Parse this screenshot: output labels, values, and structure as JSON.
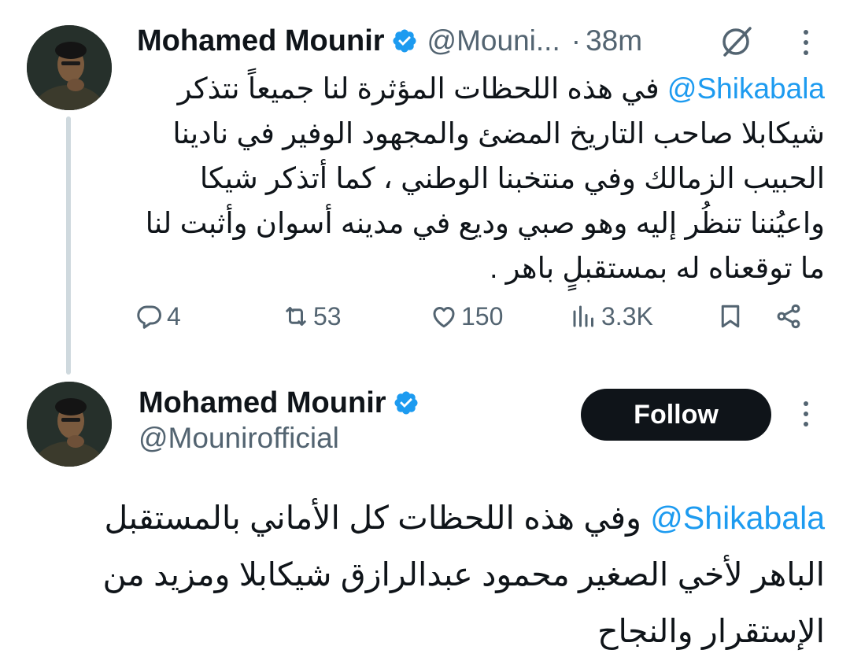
{
  "tweet1": {
    "display_name": "Mohamed Mounir",
    "handle": "@Mouni...",
    "separator": "·",
    "time": "38m",
    "mention": "@Shikabala",
    "text_after_mention": " في هذه اللحظات المؤثرة لنا جميعاً نتذكر شيكابلا صاحب التاريخ المضئ والمجهود الوفير في نادينا الحبيب الزمالك وفي منتخبنا الوطني ، كما أتذكر شيكا واعيُننا تنظُر إليه وهو صبي وديع في مدينه أسوان وأثبت لنا ما توقعناه له بمستقبلٍ باهر .",
    "actions": {
      "replies": "4",
      "retweets": "53",
      "likes": "150",
      "views": "3.3K"
    }
  },
  "tweet2": {
    "display_name": "Mohamed Mounir",
    "handle": "@Mounirofficial",
    "follow_label": "Follow",
    "mention": "@Shikabala",
    "text_after_mention": " وفي هذه اللحظات كل الأماني بالمستقبل الباهر لأخي الصغير محمود عبدالرازق شيكابلا ومزيد من الإستقرار والنجاح"
  },
  "icons": {
    "verified": "verified-badge-icon",
    "grok": "grok-icon",
    "more": "more-vertical-icon",
    "reply": "reply-icon",
    "retweet": "retweet-icon",
    "like": "heart-icon",
    "views": "views-icon",
    "bookmark": "bookmark-icon",
    "share": "share-icon"
  },
  "colors": {
    "accent": "#1d9bf0",
    "text": "#0f1419",
    "muted": "#536471",
    "follow_bg": "#0f1419"
  }
}
